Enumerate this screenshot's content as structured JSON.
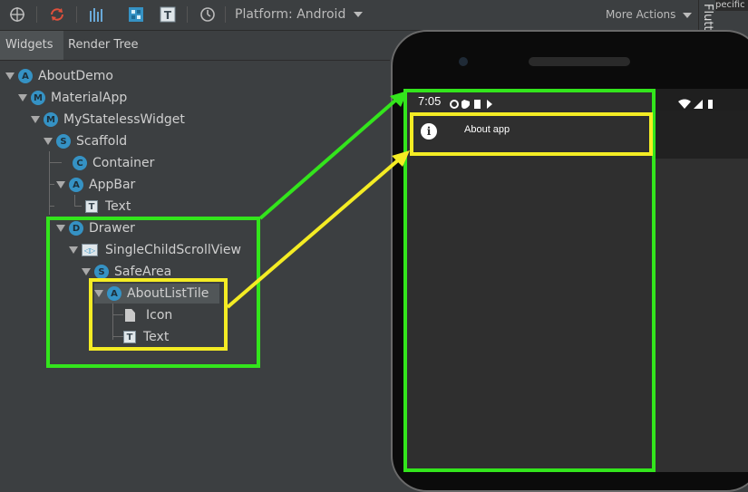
{
  "toolbar": {
    "platform_label": "Platform: Android",
    "more_actions_label": "More Actions"
  },
  "right_panel": {
    "title": "Flutt",
    "corner_text": "pecific"
  },
  "tabs": [
    {
      "label": "Widgets",
      "active": true
    },
    {
      "label": "Render Tree",
      "active": false
    }
  ],
  "tree": {
    "nodes": [
      {
        "label": "AboutDemo",
        "badge": "A"
      },
      {
        "label": "MaterialApp",
        "badge": "M"
      },
      {
        "label": "MyStatelessWidget",
        "badge": "M"
      },
      {
        "label": "Scaffold",
        "badge": "S"
      },
      {
        "label": "Container",
        "badge": "C"
      },
      {
        "label": "AppBar",
        "badge": "A"
      },
      {
        "label": "Text",
        "badge": "T"
      },
      {
        "label": "Drawer",
        "badge": "D"
      },
      {
        "label": "SingleChildScrollView",
        "badge": "◁▷"
      },
      {
        "label": "SafeArea",
        "badge": "S"
      },
      {
        "label": "AboutListTile",
        "badge": "A"
      },
      {
        "label": "Icon",
        "badge": ""
      },
      {
        "label": "Text",
        "badge": "T"
      }
    ]
  },
  "device": {
    "status_time": "7:05",
    "list_tile_label": "About app"
  },
  "colors": {
    "highlight_green": "#33e51c",
    "highlight_yellow": "#f4ec24",
    "badge_blue": "#3592c4"
  }
}
